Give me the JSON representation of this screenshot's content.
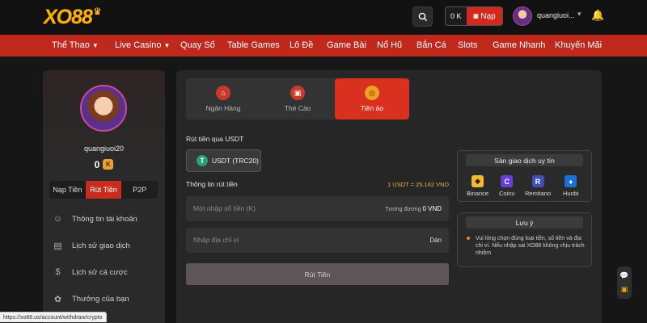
{
  "header": {
    "logo": "XO88",
    "balance": "0 K",
    "deposit_label": "Nạp",
    "username": "quangiuoi..."
  },
  "nav": [
    "Thể Thao",
    "Live Casino",
    "Quay Số",
    "Table Games",
    "Lô Đề",
    "Game Bài",
    "Nổ Hũ",
    "Bắn Cá",
    "Slots",
    "Game Nhanh",
    "Khuyến Mãi"
  ],
  "sidebar": {
    "username": "quangiuoi20",
    "balance": "0",
    "currency_badge": "K",
    "tabs": [
      "Nạp Tiền",
      "Rút Tiền",
      "P2P"
    ],
    "menu": [
      "Thông tin tài khoản",
      "Lịch sử giao dịch",
      "Lịch sử cá cược",
      "Thưởng của bạn"
    ]
  },
  "methods": [
    "Ngân Hàng",
    "Thẻ Cào",
    "Tiền ảo"
  ],
  "withdraw": {
    "title": "Rút tiền qua USDT",
    "coin": "USDT (TRC20)",
    "info_title": "Thông tin rút tiền",
    "rate": "1 USDT = 25.162 VND",
    "amount_placeholder": "Mời nhập số tiền (K)",
    "equivalent": "Tương đương",
    "equivalent_value": "0 VND",
    "address_placeholder": "Nhập địa chỉ ví",
    "paste": "Dán",
    "submit": "Rút Tiền"
  },
  "exchanges": {
    "title": "Sàn giao dịch uy tín",
    "items": [
      "Binance",
      "Coinu",
      "Remitano",
      "Huobi"
    ]
  },
  "note": {
    "title": "Lưu ý",
    "text": "Vui lòng chọn đúng loại tiền, số tiền và địa chỉ ví. Nếu nhập sai XO88 không chịu trách nhiệm"
  },
  "status_url": "https://xo88.us/account/withdraw/crypto",
  "colors": {
    "brand_red": "#c0281c",
    "accent_gold": "#e8b04a"
  }
}
